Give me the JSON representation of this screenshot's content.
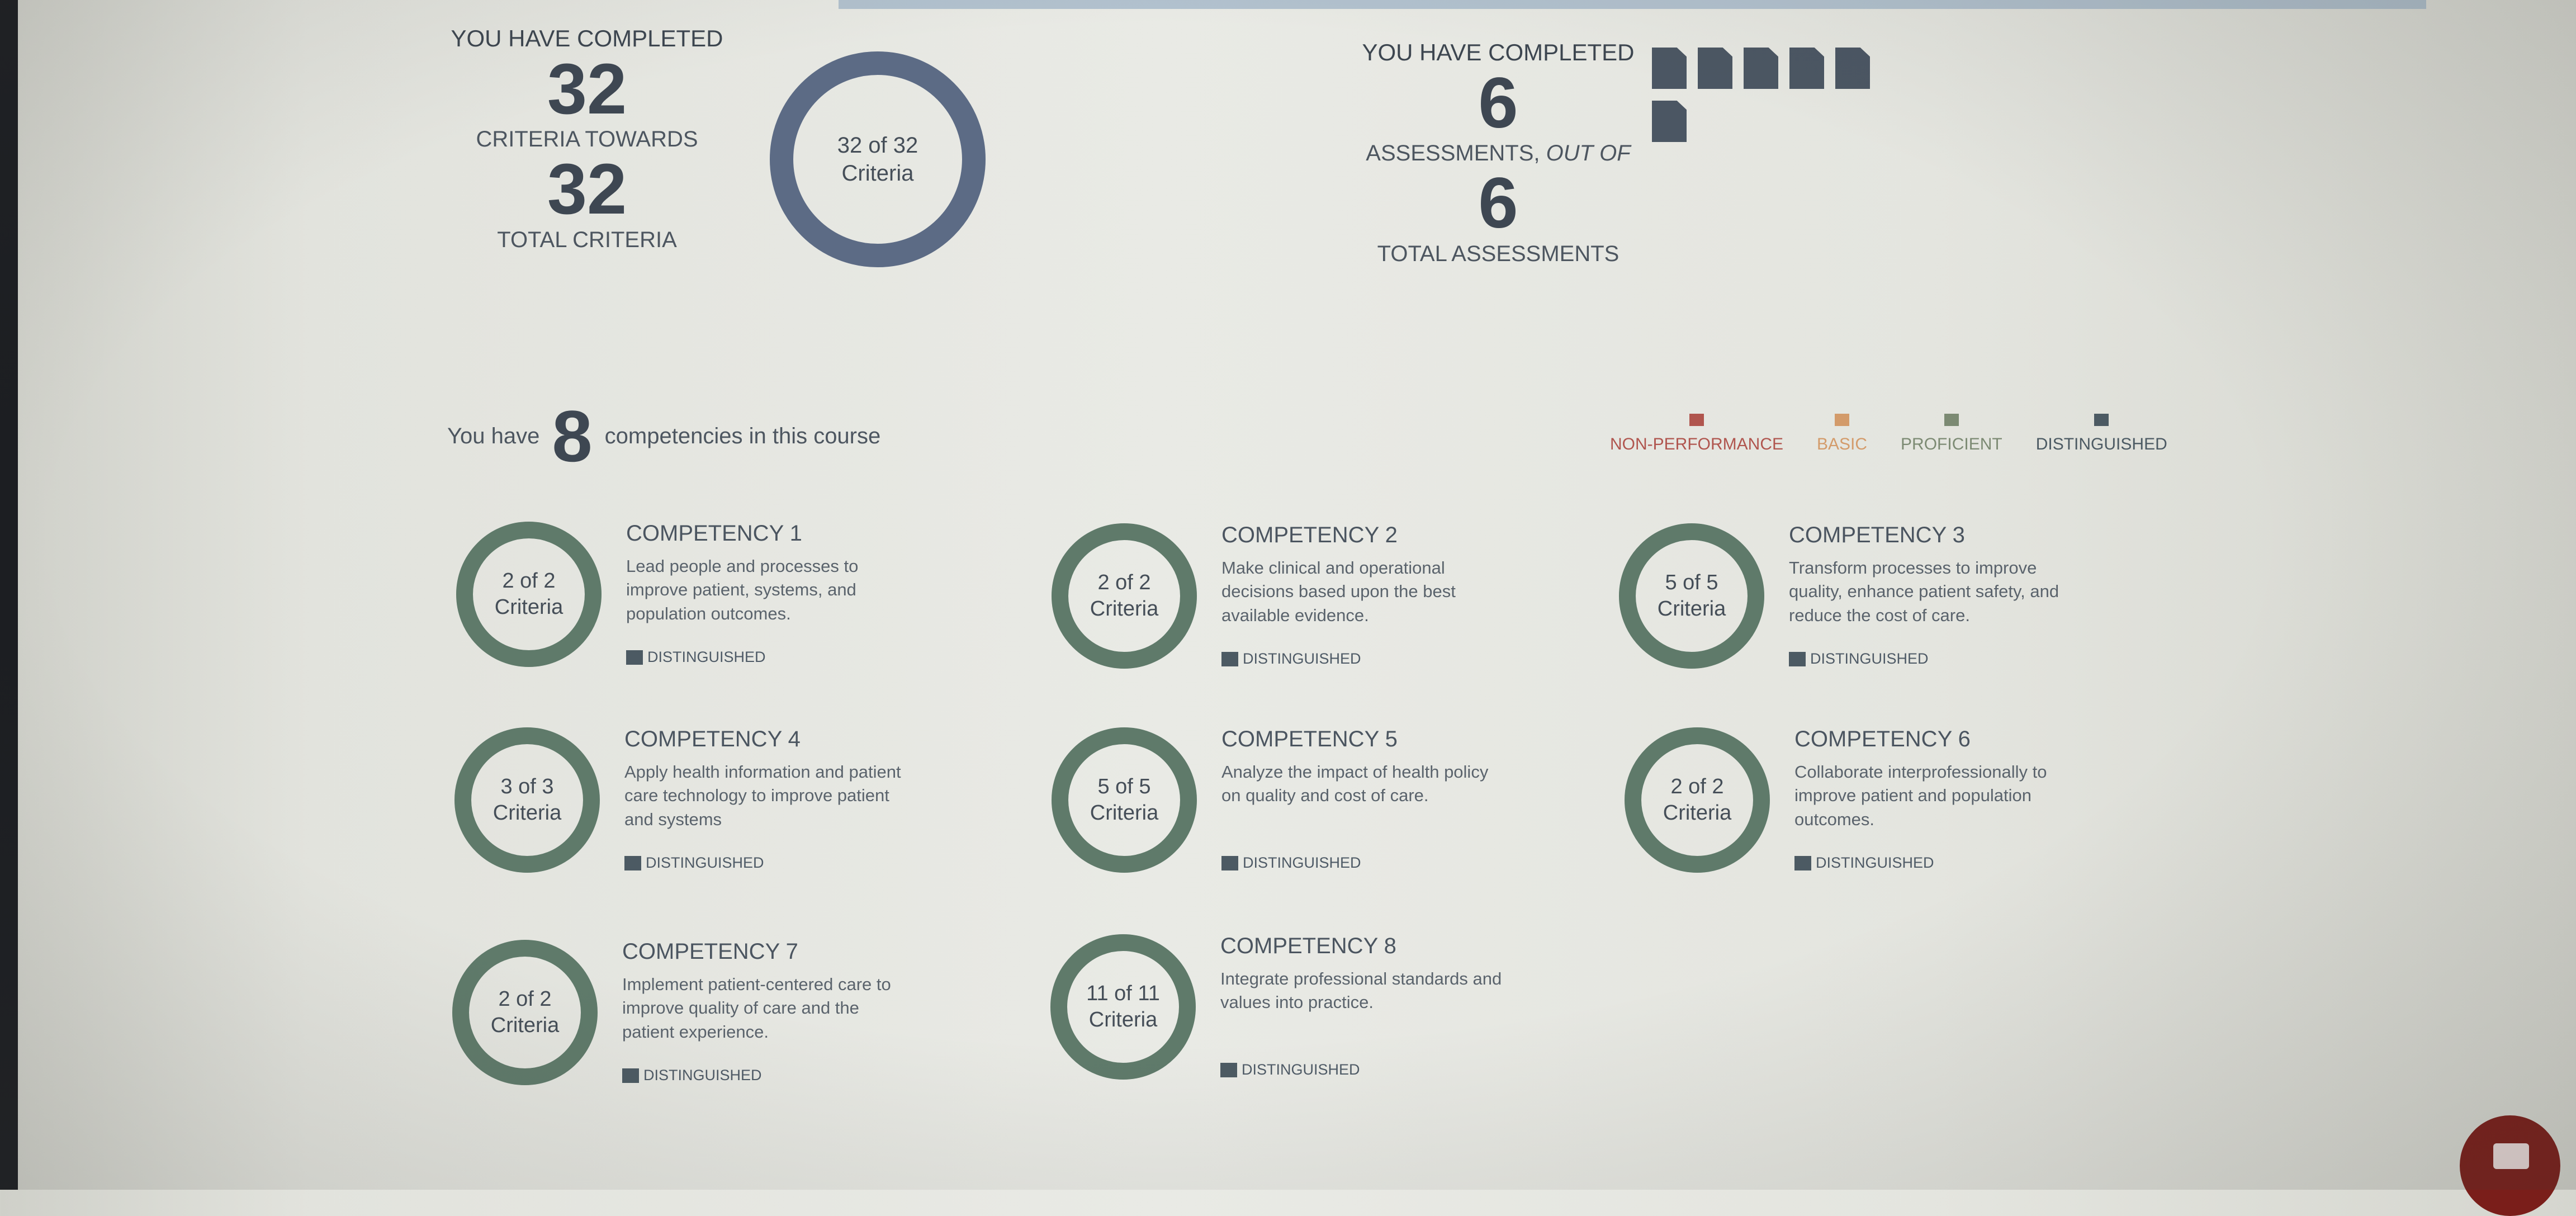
{
  "summary": {
    "left": {
      "heading": "YOU HAVE COMPLETED",
      "completed": "32",
      "towards_label": "CRITERIA TOWARDS",
      "total": "32",
      "total_label": "TOTAL CRITERIA",
      "ring_line1": "32 of 32",
      "ring_line2": "Criteria",
      "fraction": 1.0
    },
    "right": {
      "heading": "YOU HAVE COMPLETED",
      "completed": "6",
      "out_of_label_a": "ASSESSMENTS, ",
      "out_of_label_b": "OUT OF",
      "total": "6",
      "total_label": "TOTAL ASSESSMENTS",
      "icon": "document-icon",
      "icon_count": 6
    }
  },
  "competency_intro": {
    "prefix": "You have",
    "count": "8",
    "suffix": "competencies in this course"
  },
  "legend": [
    {
      "label": "NON-PERFORMANCE",
      "color": "#b0554e"
    },
    {
      "label": "BASIC",
      "color": "#d39b6a"
    },
    {
      "label": "PROFICIENT",
      "color": "#7c8a73"
    },
    {
      "label": "DISTINGUISHED",
      "color": "#4c5a63"
    }
  ],
  "ring_color": "#5f7a6a",
  "overall_ring_color": "#5c6b85",
  "competencies": [
    {
      "title": "COMPETENCY 1",
      "ring_line1": "2 of 2",
      "ring_line2": "Criteria",
      "fraction": 1.0,
      "description": "Lead people and processes to improve patient, systems, and population outcomes.",
      "status": "DISTINGUISHED"
    },
    {
      "title": "COMPETENCY 2",
      "ring_line1": "2 of 2",
      "ring_line2": "Criteria",
      "fraction": 1.0,
      "description": "Make clinical and operational decisions based upon the best available evidence.",
      "status": "DISTINGUISHED"
    },
    {
      "title": "COMPETENCY 3",
      "ring_line1": "5 of 5",
      "ring_line2": "Criteria",
      "fraction": 1.0,
      "description": "Transform processes to improve quality, enhance patient safety, and reduce the cost of care.",
      "status": "DISTINGUISHED"
    },
    {
      "title": "COMPETENCY 4",
      "ring_line1": "3 of 3",
      "ring_line2": "Criteria",
      "fraction": 1.0,
      "description": "Apply health information and patient care technology to improve patient and systems",
      "status": "DISTINGUISHED"
    },
    {
      "title": "COMPETENCY 5",
      "ring_line1": "5 of 5",
      "ring_line2": "Criteria",
      "fraction": 1.0,
      "description": "Analyze the impact of health policy on quality and cost of care.",
      "status": "DISTINGUISHED"
    },
    {
      "title": "COMPETENCY 6",
      "ring_line1": "2 of 2",
      "ring_line2": "Criteria",
      "fraction": 1.0,
      "description": "Collaborate interprofessionally to improve patient and population outcomes.",
      "status": "DISTINGUISHED"
    },
    {
      "title": "COMPETENCY 7",
      "ring_line1": "2 of 2",
      "ring_line2": "Criteria",
      "fraction": 1.0,
      "description": "Implement patient-centered care to improve quality of care and the patient experience.",
      "status": "DISTINGUISHED"
    },
    {
      "title": "COMPETENCY 8",
      "ring_line1": "11 of 11",
      "ring_line2": "Criteria",
      "fraction": 1.0,
      "description": "Integrate professional standards and values into practice.",
      "status": "DISTINGUISHED"
    }
  ]
}
